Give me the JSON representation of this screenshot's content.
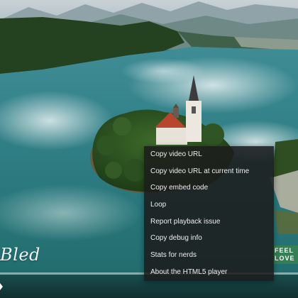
{
  "video": {
    "caption": "Bled",
    "logo_line1": "FEEL",
    "logo_line2": "LOVE",
    "progress_fraction": 0.0
  },
  "context_menu": {
    "items": [
      {
        "label": "Copy video URL"
      },
      {
        "label": "Copy video URL at current time"
      },
      {
        "label": "Copy embed code"
      },
      {
        "label": "Loop"
      },
      {
        "label": "Report playback issue"
      },
      {
        "label": "Copy debug info"
      },
      {
        "label": "Stats for nerds"
      },
      {
        "label": "About the HTML5 player"
      }
    ]
  }
}
